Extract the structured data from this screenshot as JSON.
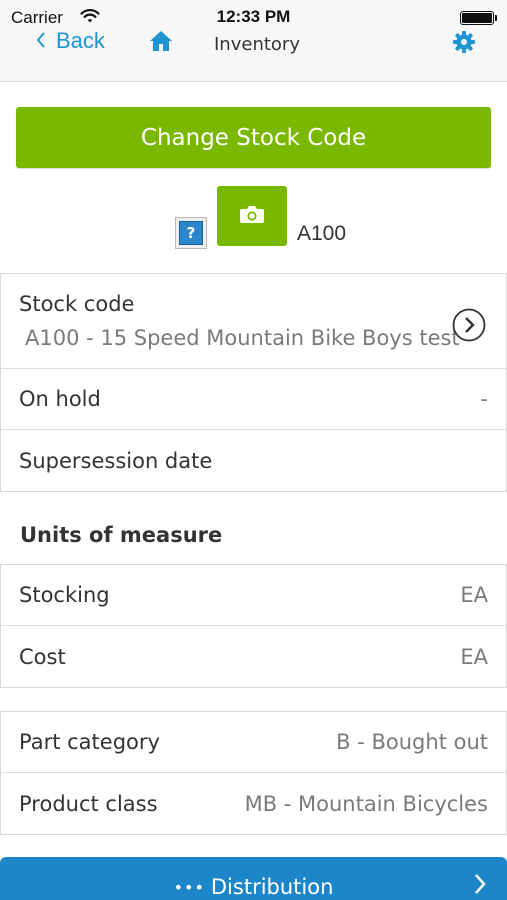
{
  "status_bar": {
    "carrier": "Carrier",
    "time": "12:33 PM"
  },
  "nav": {
    "back_label": "Back",
    "title": "Inventory",
    "home_icon": "home-icon",
    "settings_icon": "gear-icon"
  },
  "actions": {
    "change_stock_code": "Change Stock Code"
  },
  "image_row": {
    "placeholder_icon": "?",
    "camera_icon": "camera-icon",
    "code": "A100"
  },
  "details": {
    "stock_code_label": "Stock code",
    "stock_code_value": "A100 - 15 Speed Mountain Bike Boys test",
    "on_hold_label": "On hold",
    "on_hold_value": "-",
    "supersession_label": "Supersession date",
    "supersession_value": ""
  },
  "units_of_measure": {
    "title": "Units of measure",
    "stocking_label": "Stocking",
    "stocking_value": "EA",
    "cost_label": "Cost",
    "cost_value": "EA"
  },
  "classification": {
    "part_category_label": "Part category",
    "part_category_value": "B - Bought out",
    "product_class_label": "Product class",
    "product_class_value": "MB - Mountain Bicycles"
  },
  "footer": {
    "distribution_label": "Distribution",
    "dots": "•••"
  },
  "colors": {
    "accent_green": "#7ab800",
    "accent_blue": "#1e94d2",
    "footer_blue": "#1d86c8"
  }
}
